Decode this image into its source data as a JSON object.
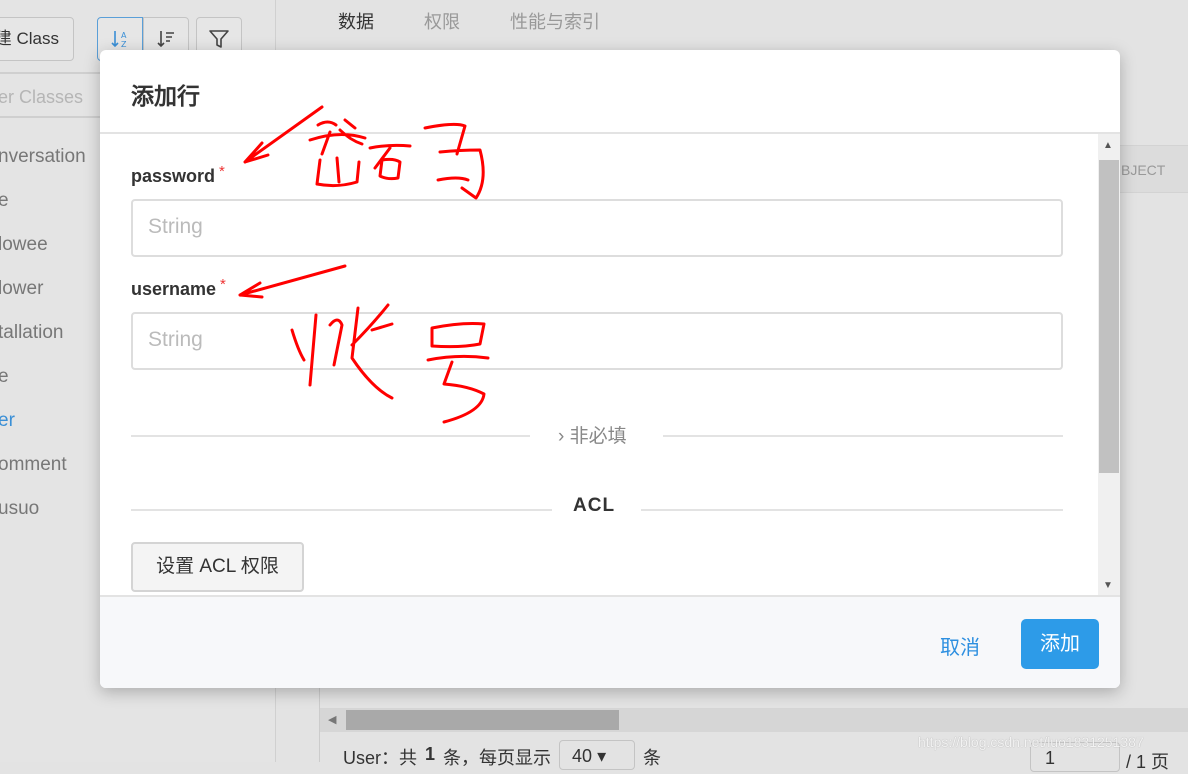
{
  "sidebar": {
    "new_class_label": "建 Class",
    "search_placeholder": "Filter Classes",
    "search_visible": "er Classes",
    "classes": [
      "nversation",
      "e",
      "lowee",
      "lower",
      "tallation",
      "e",
      "er",
      "omment",
      "usuo"
    ],
    "active_index": 6
  },
  "tabs": [
    "数据",
    "权限",
    "性能与索引"
  ],
  "table": {
    "column_header": "BJECT"
  },
  "pager": {
    "prefix": "User：共",
    "count": "1",
    "mid": "条，每页显示",
    "page_size": "40",
    "suffix": "条",
    "page": "1",
    "total": "/ 1 页"
  },
  "watermark": "https://blog.csdn.net/luo1831251387",
  "modal": {
    "title": "添加行",
    "fields": [
      {
        "label": "password",
        "required": "*",
        "placeholder": "String"
      },
      {
        "label": "username",
        "required": "*",
        "placeholder": "String"
      }
    ],
    "optional_toggle": "非必填",
    "acl_heading": "ACL",
    "acl_button": "设置 ACL 权限",
    "cancel": "取消",
    "submit": "添加"
  },
  "annotations": {
    "password_note": "密码",
    "username_note": "帐号",
    "color": "#ff0000"
  },
  "colors": {
    "accent": "#2d9be8",
    "link": "#2d8fe0",
    "required": "#e33333"
  }
}
